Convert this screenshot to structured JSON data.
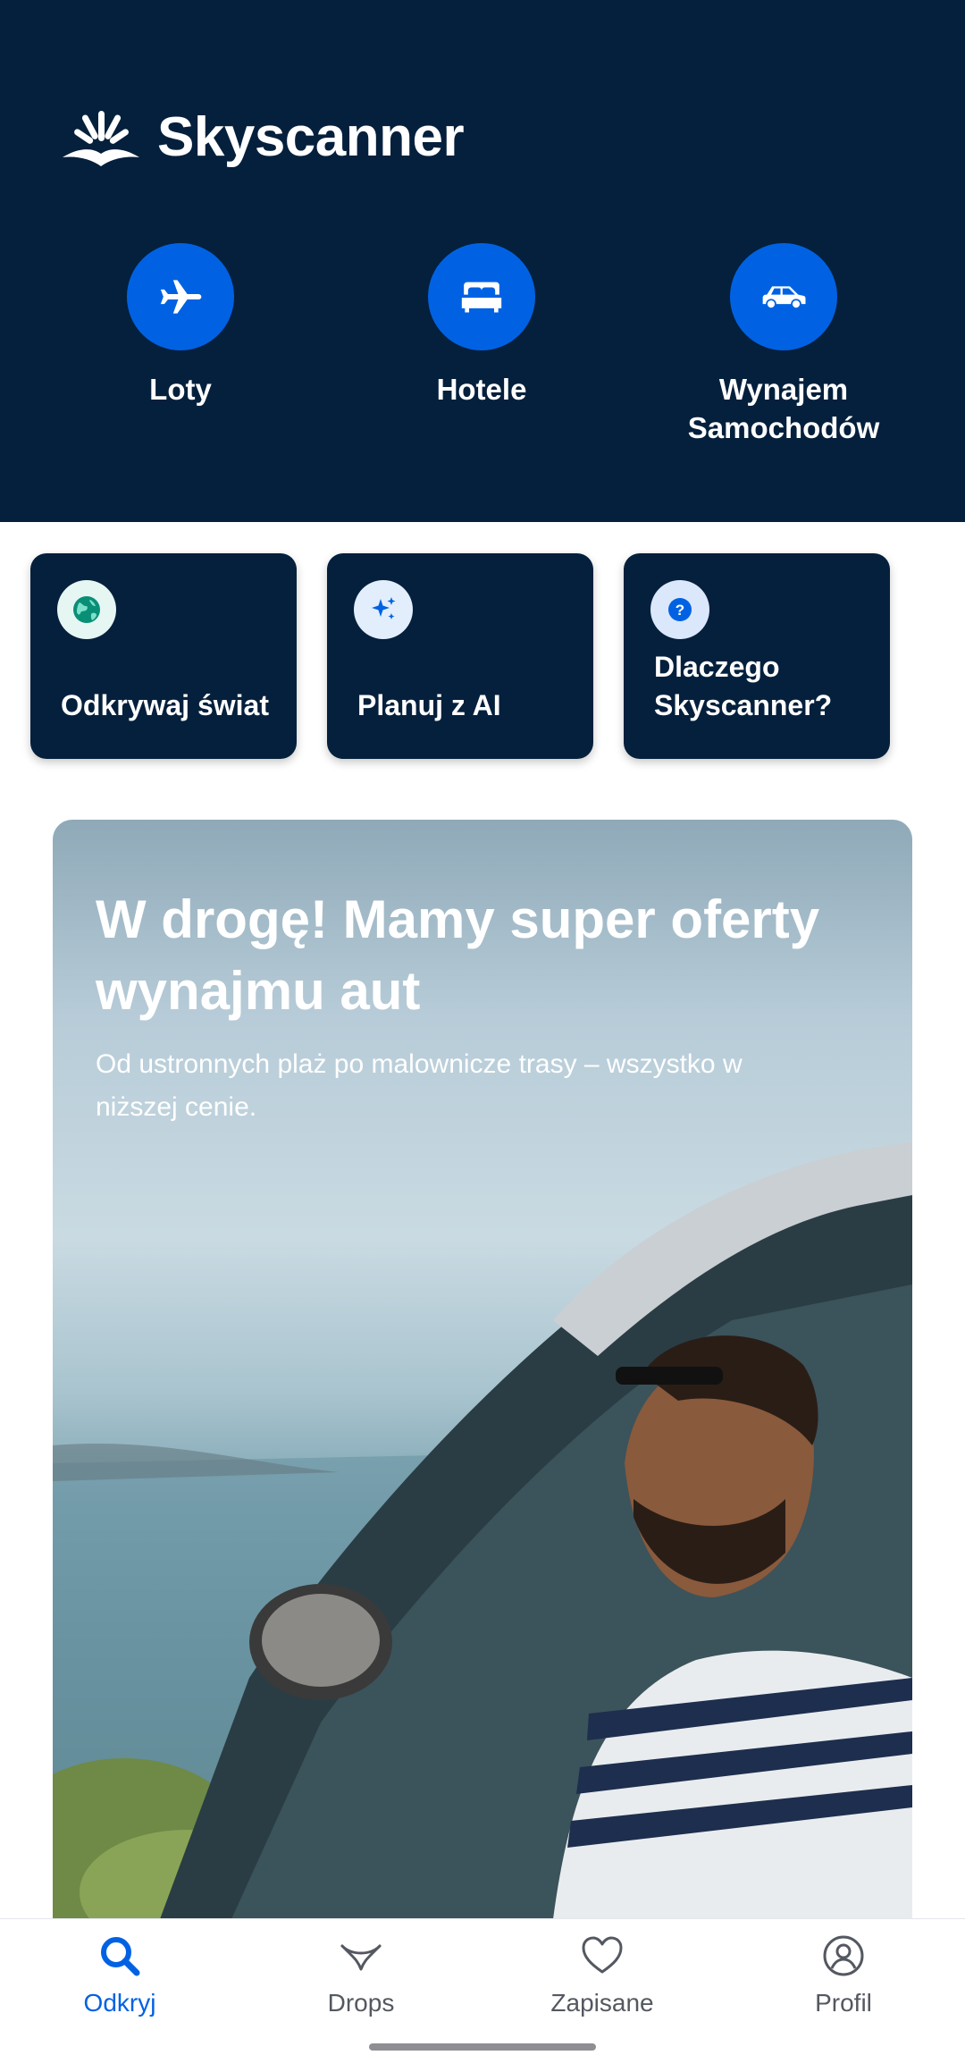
{
  "app": {
    "brand": "Skyscanner"
  },
  "colors": {
    "header_bg": "#05203c",
    "accent": "#0062e3",
    "nav_inactive": "#545860"
  },
  "verticals": [
    {
      "label": "Loty",
      "icon": "plane-icon"
    },
    {
      "label": "Hotele",
      "icon": "bed-icon"
    },
    {
      "label": "Wynajem Samochodów",
      "icon": "car-icon"
    }
  ],
  "quick_cards": [
    {
      "title": "Odkrywaj świat",
      "icon": "globe-icon"
    },
    {
      "title": "Planuj z AI",
      "icon": "sparkles-icon"
    },
    {
      "title": "Dlaczego Skyscanner?",
      "icon": "question-icon"
    }
  ],
  "promo": {
    "title": "W drogę! Mamy super oferty wynajmu aut",
    "subtitle": "Od ustronnych plaż po malownicze trasy – wszystko w niższej cenie."
  },
  "bottom_nav": [
    {
      "label": "Odkryj",
      "icon": "search-icon",
      "active": true
    },
    {
      "label": "Drops",
      "icon": "drops-icon",
      "active": false
    },
    {
      "label": "Zapisane",
      "icon": "heart-icon",
      "active": false
    },
    {
      "label": "Profil",
      "icon": "profile-icon",
      "active": false
    }
  ]
}
